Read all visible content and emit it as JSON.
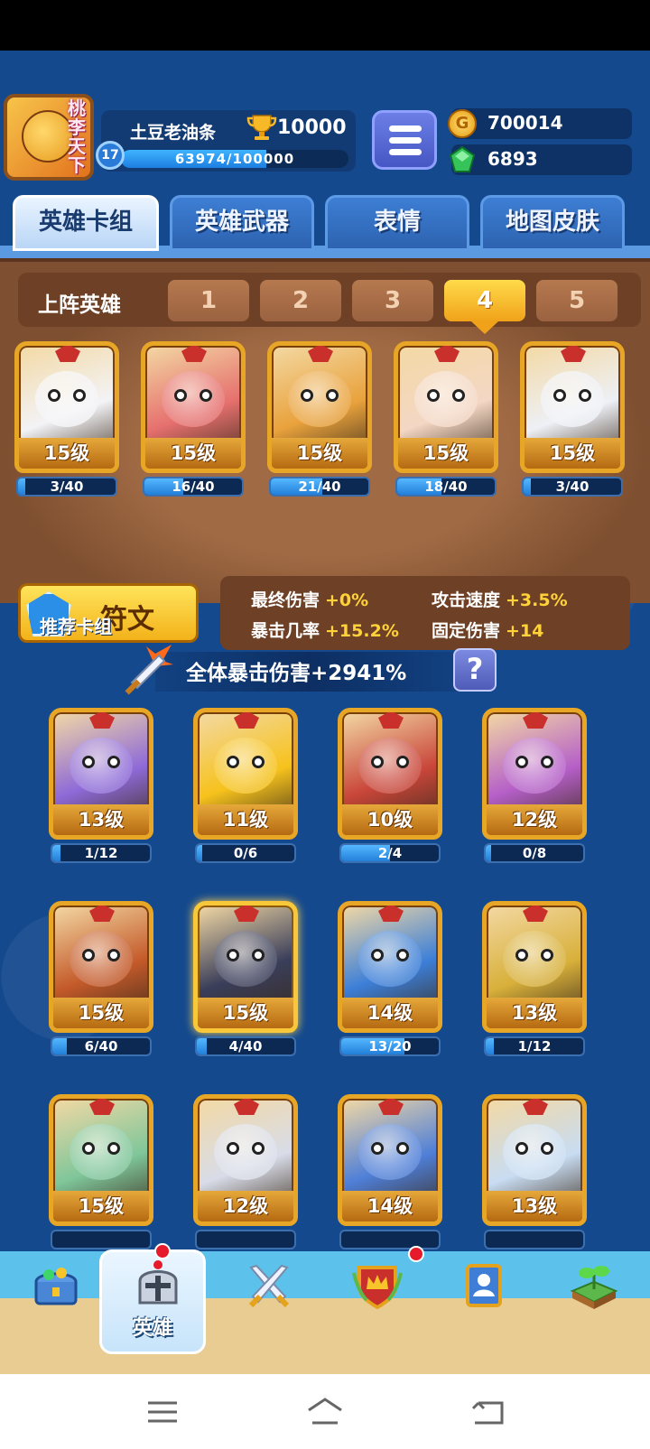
{
  "player": {
    "avatar_text": "桃李天下",
    "name": "土豆老油条",
    "trophies": "10000",
    "level": "17",
    "xp": "63974/100000",
    "xp_fraction": 0.64
  },
  "currency": {
    "gold": "700014",
    "gems": "6893",
    "gold_symbol": "G"
  },
  "tabs": [
    "英雄卡组",
    "英雄武器",
    "表情",
    "地图皮肤"
  ],
  "lineup": {
    "label": "上阵英雄",
    "slots": [
      "1",
      "2",
      "3",
      "4",
      "5"
    ],
    "active_slot": "4",
    "heroes": [
      {
        "level": "15级",
        "progress": "3/40",
        "fraction": 0.075,
        "color": "#f3f3f6"
      },
      {
        "level": "15级",
        "progress": "16/40",
        "fraction": 0.4,
        "color": "#e6706e"
      },
      {
        "level": "15级",
        "progress": "21/40",
        "fraction": 0.525,
        "color": "#e9a23c"
      },
      {
        "level": "15级",
        "progress": "18/40",
        "fraction": 0.45,
        "color": "#f4d7c4"
      },
      {
        "level": "15级",
        "progress": "3/40",
        "fraction": 0.075,
        "color": "#eef0f6"
      }
    ]
  },
  "rune": {
    "label": "符文"
  },
  "stats": [
    {
      "name": "最终伤害",
      "value": "+0%"
    },
    {
      "name": "攻击速度",
      "value": "+3.5%"
    },
    {
      "name": "暴击几率",
      "value": "+15.2%"
    },
    {
      "name": "固定伤害",
      "value": "+14"
    }
  ],
  "recommended": {
    "label": "推荐卡组",
    "crit_text": "全体暴击伤害+2941%",
    "help": "?"
  },
  "collection": [
    {
      "level": "13级",
      "progress": "1/12",
      "fraction": 0.083,
      "color": "#8e6ad8"
    },
    {
      "level": "11级",
      "progress": "0/6",
      "fraction": 0.0,
      "color": "#f6c21c"
    },
    {
      "level": "10级",
      "progress": "2/4",
      "fraction": 0.5,
      "color": "#c9463a"
    },
    {
      "level": "12级",
      "progress": "0/8",
      "fraction": 0.0,
      "color": "#b55fc8"
    },
    {
      "level": "15级",
      "progress": "6/40",
      "fraction": 0.15,
      "color": "#c45a2a"
    },
    {
      "level": "15级",
      "progress": "4/40",
      "fraction": 0.1,
      "color": "#3a3e5a",
      "gold": true
    },
    {
      "level": "14级",
      "progress": "13/20",
      "fraction": 0.65,
      "color": "#3c7fd8"
    },
    {
      "level": "13级",
      "progress": "1/12",
      "fraction": 0.083,
      "color": "#d8b03a"
    },
    {
      "level": "15级",
      "progress": "",
      "fraction": 0.0,
      "color": "#7fc69a"
    },
    {
      "level": "12级",
      "progress": "",
      "fraction": 0.0,
      "color": "#d8dce8"
    },
    {
      "level": "14级",
      "progress": "",
      "fraction": 0.0,
      "color": "#4f7fd8"
    },
    {
      "level": "13级",
      "progress": "",
      "fraction": 0.0,
      "color": "#c8dcf2"
    }
  ],
  "bottom_nav": [
    {
      "icon": "treasure-chest-icon",
      "label": ""
    },
    {
      "icon": "helmet-icon",
      "label": "英雄"
    },
    {
      "icon": "crossed-swords-icon",
      "label": ""
    },
    {
      "icon": "crown-shield-icon",
      "label": ""
    },
    {
      "icon": "social-scroll-icon",
      "label": ""
    },
    {
      "icon": "sprout-map-icon",
      "label": ""
    }
  ]
}
